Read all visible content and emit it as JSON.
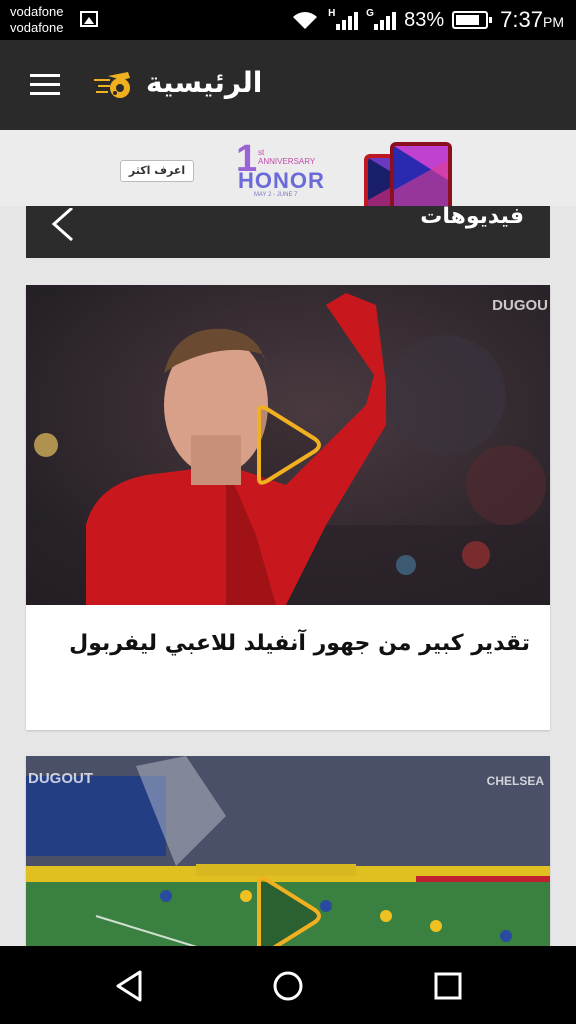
{
  "status_bar": {
    "carrier_line1": "vodafone",
    "carrier_line2": "vodafone",
    "network_1": "H",
    "network_2": "G",
    "battery_percent": "83%",
    "battery_level": 0.83,
    "time": "7:37",
    "time_suffix": "PM",
    "icons": [
      "gallery-icon",
      "wifi-icon",
      "signal-icon",
      "battery-icon"
    ]
  },
  "app_bar": {
    "title": "الرئيسية",
    "icons": [
      "menu-icon",
      "logo-icon"
    ]
  },
  "ad": {
    "cta": "اعرف اكثر",
    "brand_number": "1",
    "brand_anniversary_line1": "st",
    "brand_anniversary_line2": "ANNIVERSARY",
    "brand_name": "HONOR",
    "brand_dates": "MAY 2 - JUNE 7"
  },
  "section": {
    "title": "فيديوهات",
    "icon": "chevron-left-icon"
  },
  "cards": [
    {
      "title": "تقدير كبير من جهور آنفيلد للاعبي ليفربول",
      "watermark": "DUGOU",
      "icon": "play-icon"
    },
    {
      "title": "",
      "watermark_left": "DUGOUT",
      "watermark_right": "CHELSEA",
      "icon": "play-icon"
    }
  ],
  "nav_bar": {
    "icons": [
      "back-icon",
      "home-icon",
      "recents-icon"
    ]
  },
  "colors": {
    "app_bar": "#2a2a2a",
    "accent_play": "#f0b020",
    "background": "#e6e6e6"
  }
}
